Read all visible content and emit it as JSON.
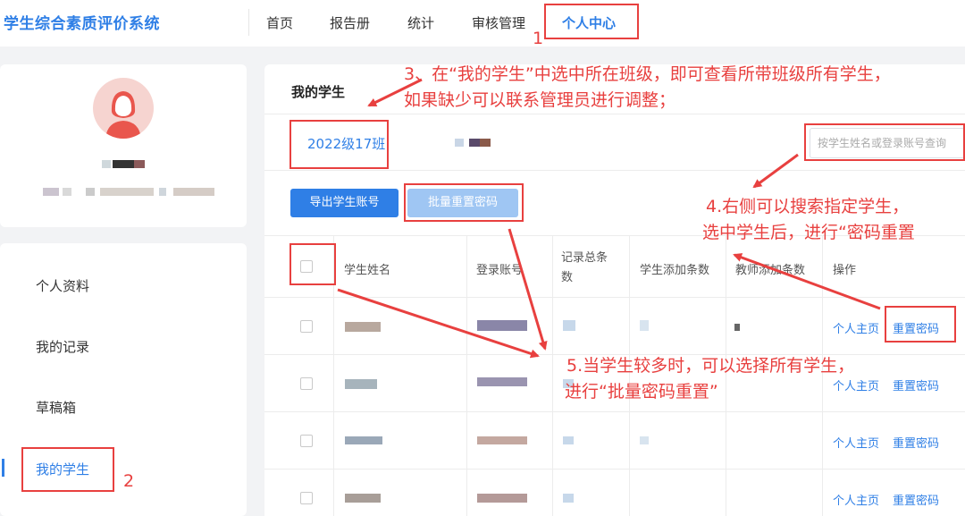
{
  "app_title": "学生综合素质评价系统",
  "nav": {
    "home": "首页",
    "reports": "报告册",
    "stats": "统计",
    "review": "审核管理",
    "personal": "个人中心"
  },
  "sidebar": {
    "items": [
      "个人资料",
      "我的记录",
      "草稿箱",
      "我的学生"
    ]
  },
  "main": {
    "title": "我的学生",
    "class_tab": "2022级17班",
    "search_placeholder": "按学生姓名或登录账号查询",
    "export_button": "导出学生账号",
    "batch_reset_button": "批量重置密码",
    "columns": [
      "学生姓名",
      "登录账号",
      "记录总条数",
      "学生添加条数",
      "教师添加条数",
      "操作"
    ],
    "row_actions": {
      "home": "个人主页",
      "reset": "重置密码"
    }
  },
  "annotations": {
    "n1": "1",
    "n2": "2",
    "step3_line1": "3、在“我的学生”中选中所在班级，即可查看所带班级所有学生，",
    "step3_line2": "如果缺少可以联系管理员进行调整；",
    "step4_line1": "4.右侧可以搜索指定学生，",
    "step4_line2": "选中学生后，进行“密码重置",
    "step5_line1": "5.当学生较多时，可以选择所有学生，",
    "step5_line2": "进行“批量密码重置”"
  },
  "colors": {
    "accent": "#2f7fe6",
    "annotation": "#e8403f"
  }
}
